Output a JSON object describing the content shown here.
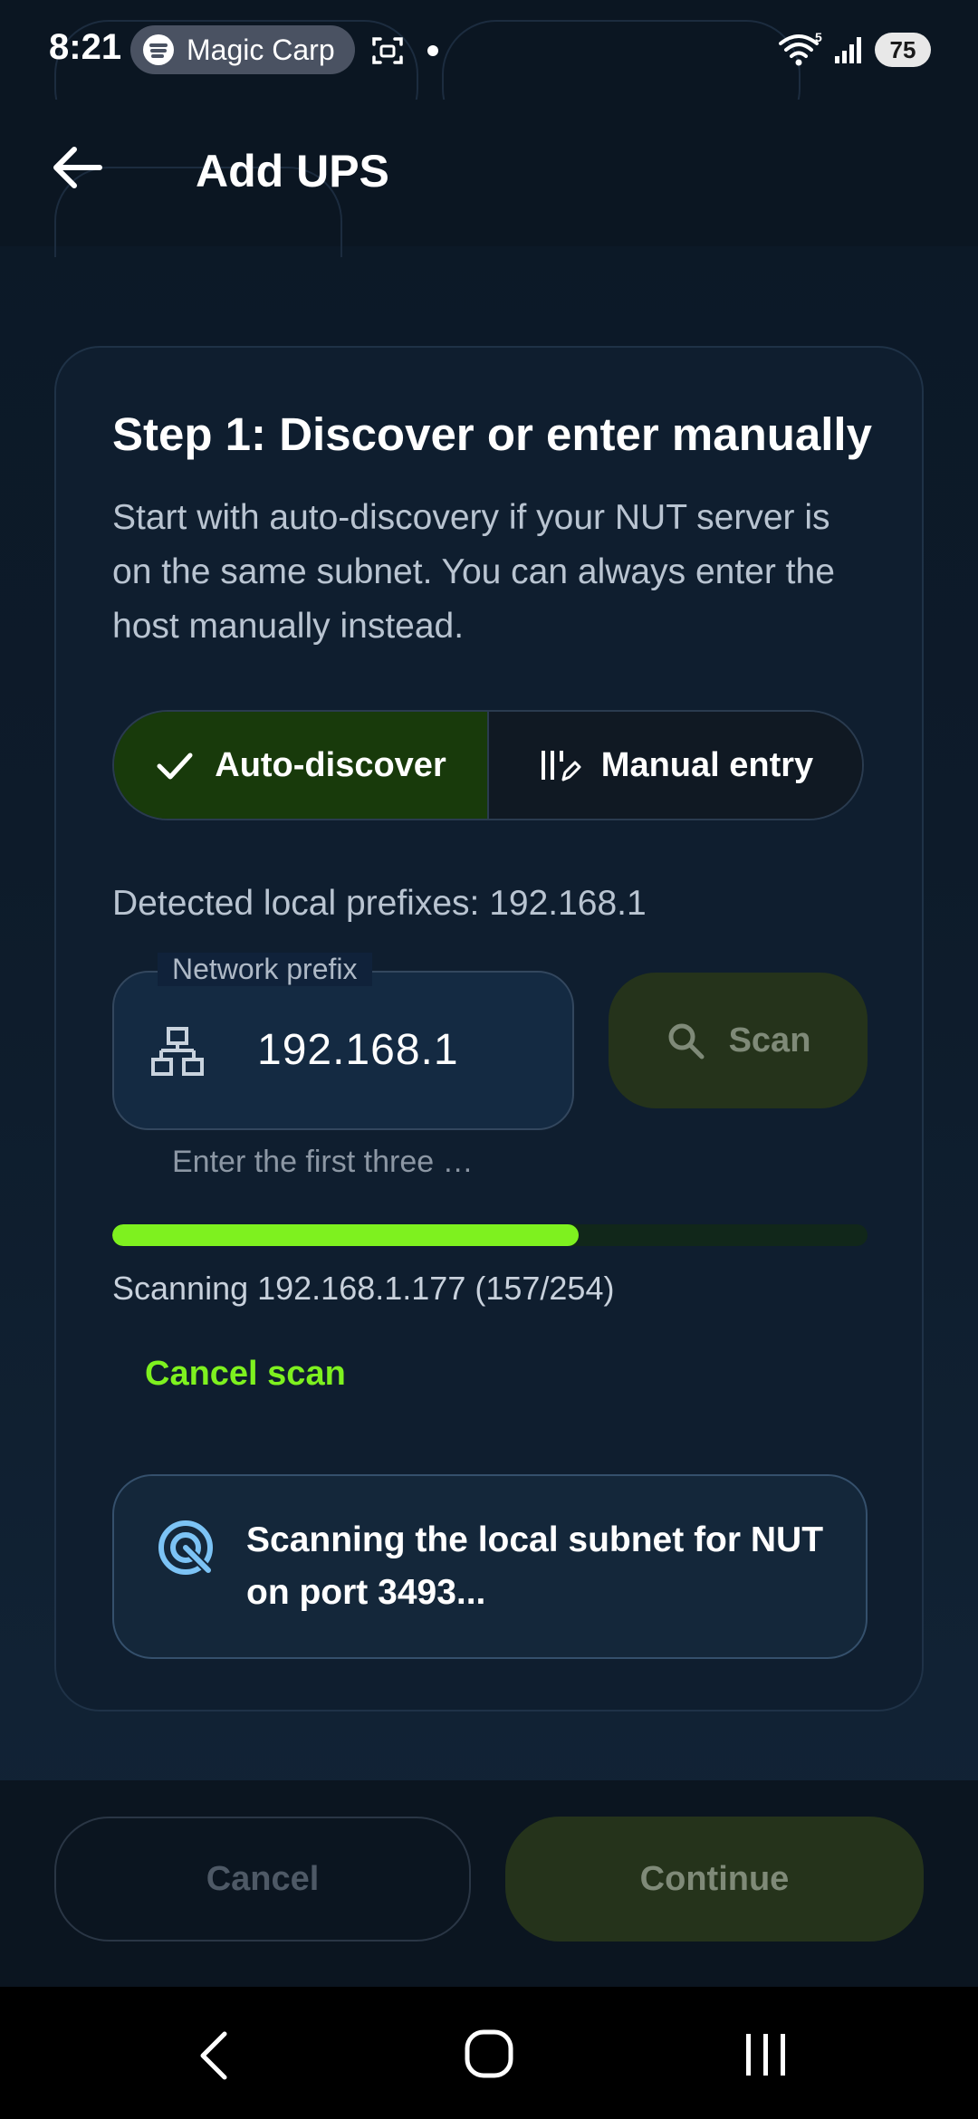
{
  "status_bar": {
    "time": "8:21",
    "media_chip_label": "Magic Carp",
    "battery_level": "75",
    "wifi_badge": "5",
    "icons": [
      "spotify-icon",
      "screenshot-icon",
      "wifi-icon",
      "signal-icon",
      "battery-icon"
    ]
  },
  "app_bar": {
    "title": "Add UPS",
    "back_icon": "arrow-left-icon"
  },
  "step": {
    "title": "Step 1: Discover or enter manually",
    "description": "Start with auto-discovery if your NUT server is on the same subnet. You can always enter the host manually instead."
  },
  "mode_toggle": {
    "selected": "auto",
    "auto_label": "Auto-discover",
    "manual_label": "Manual entry"
  },
  "detected_prefixes": "Detected local prefixes: 192.168.1",
  "network_prefix": {
    "label": "Network prefix",
    "value": "192.168.1",
    "helper": "Enter the first three …"
  },
  "scan_button_label": "Scan",
  "scan_progress": {
    "fraction": 0.618,
    "status": "Scanning 192.168.1.177 (157/254)",
    "cancel_label": "Cancel scan"
  },
  "info_message": "Scanning the local subnet for NUT on port 3493...",
  "actions": {
    "cancel_label": "Cancel",
    "continue_label": "Continue"
  },
  "colors": {
    "accent_green": "#7ef11f",
    "selected_segment": "#183a0b",
    "card_background": "#0f1e2f",
    "disabled_button": "#25331b"
  }
}
